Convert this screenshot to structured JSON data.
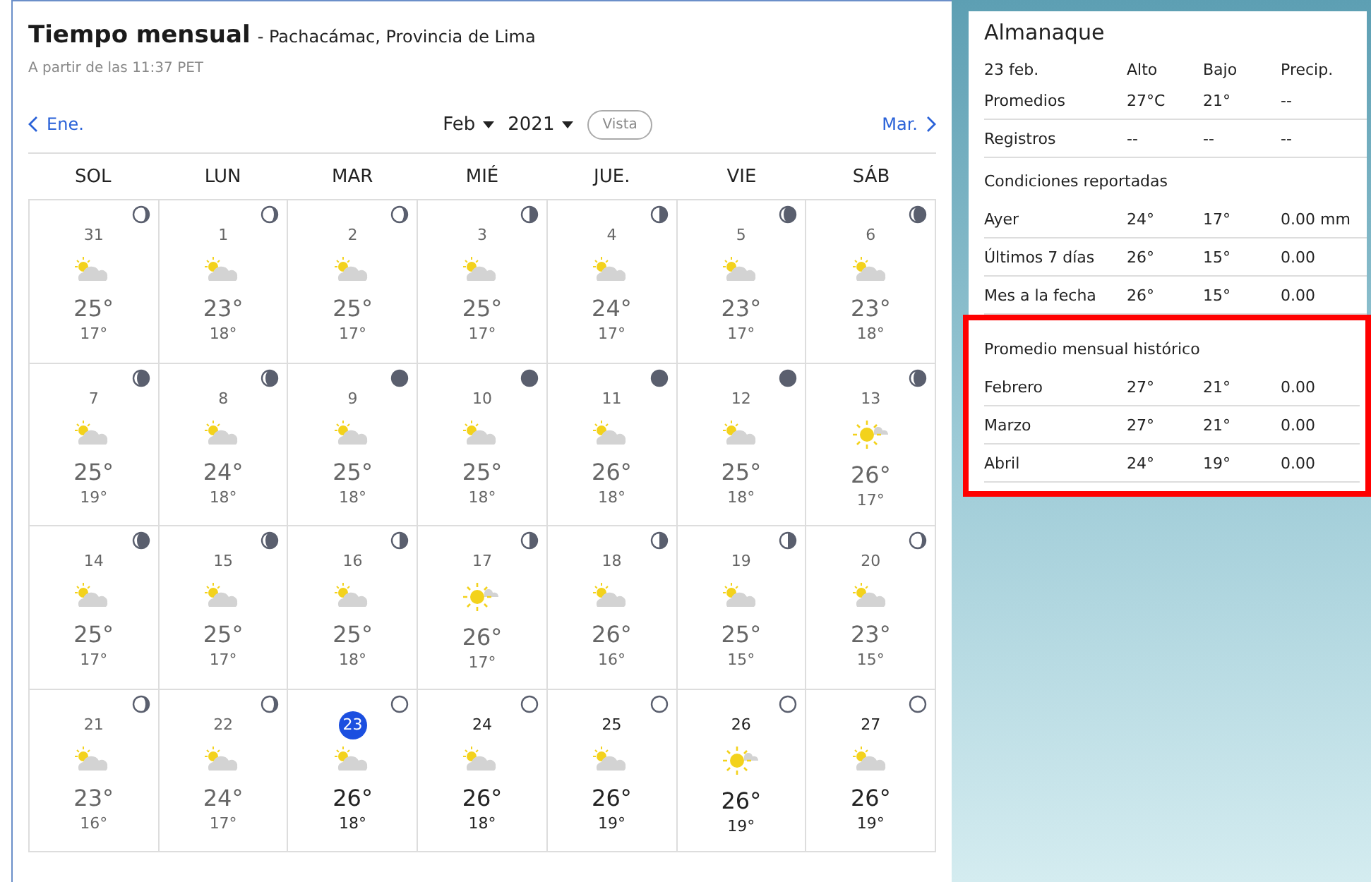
{
  "header": {
    "title": "Tiempo mensual",
    "location": "- Pachacámac, Provincia de Lima",
    "updated": "A partir de las 11:37 PET"
  },
  "nav": {
    "prev": "Ene.",
    "next": "Mar.",
    "month": "Feb",
    "year": "2021",
    "view_button": "Vista"
  },
  "weekdays": [
    "SOL",
    "LUN",
    "MAR",
    "MIÉ",
    "JUE.",
    "VIE",
    "SÁB"
  ],
  "days": [
    {
      "day": "31",
      "high": "25°",
      "low": "17°",
      "kind": "partly",
      "moon": {
        "kind": "crescent"
      },
      "past": true,
      "selected": false
    },
    {
      "day": "1",
      "high": "23°",
      "low": "18°",
      "kind": "partly",
      "moon": {
        "kind": "crescent"
      },
      "past": true,
      "selected": false
    },
    {
      "day": "2",
      "high": "25°",
      "low": "17°",
      "kind": "partly",
      "moon": {
        "kind": "crescent"
      },
      "past": true,
      "selected": false
    },
    {
      "day": "3",
      "high": "25°",
      "low": "17°",
      "kind": "partly",
      "moon": {
        "kind": "half"
      },
      "past": true,
      "selected": false
    },
    {
      "day": "4",
      "high": "24°",
      "low": "17°",
      "kind": "partly",
      "moon": {
        "kind": "half"
      },
      "past": true,
      "selected": false
    },
    {
      "day": "5",
      "high": "23°",
      "low": "17°",
      "kind": "partly",
      "moon": {
        "kind": "gibbous"
      },
      "past": true,
      "selected": false
    },
    {
      "day": "6",
      "high": "23°",
      "low": "18°",
      "kind": "partly",
      "moon": {
        "kind": "gibbous"
      },
      "past": true,
      "selected": false
    },
    {
      "day": "7",
      "high": "25°",
      "low": "19°",
      "kind": "partly",
      "moon": {
        "kind": "gibbous"
      },
      "past": true,
      "selected": false
    },
    {
      "day": "8",
      "high": "24°",
      "low": "18°",
      "kind": "partly",
      "moon": {
        "kind": "gibbous"
      },
      "past": true,
      "selected": false
    },
    {
      "day": "9",
      "high": "25°",
      "low": "18°",
      "kind": "partly",
      "moon": {
        "kind": "full"
      },
      "past": true,
      "selected": false
    },
    {
      "day": "10",
      "high": "25°",
      "low": "18°",
      "kind": "partly",
      "moon": {
        "kind": "full"
      },
      "past": true,
      "selected": false
    },
    {
      "day": "11",
      "high": "26°",
      "low": "18°",
      "kind": "partly",
      "moon": {
        "kind": "full"
      },
      "past": true,
      "selected": false
    },
    {
      "day": "12",
      "high": "25°",
      "low": "18°",
      "kind": "partly",
      "moon": {
        "kind": "full"
      },
      "past": true,
      "selected": false
    },
    {
      "day": "13",
      "high": "26°",
      "low": "17°",
      "kind": "sunny",
      "moon": {
        "kind": "gibbous"
      },
      "past": true,
      "selected": false
    },
    {
      "day": "14",
      "high": "25°",
      "low": "17°",
      "kind": "partly",
      "moon": {
        "kind": "gibbous"
      },
      "past": true,
      "selected": false
    },
    {
      "day": "15",
      "high": "25°",
      "low": "17°",
      "kind": "partly",
      "moon": {
        "kind": "gibbous"
      },
      "past": true,
      "selected": false
    },
    {
      "day": "16",
      "high": "25°",
      "low": "18°",
      "kind": "partly",
      "moon": {
        "kind": "half"
      },
      "past": true,
      "selected": false
    },
    {
      "day": "17",
      "high": "26°",
      "low": "17°",
      "kind": "sunny",
      "moon": {
        "kind": "half"
      },
      "past": true,
      "selected": false
    },
    {
      "day": "18",
      "high": "26°",
      "low": "16°",
      "kind": "partly",
      "moon": {
        "kind": "half"
      },
      "past": true,
      "selected": false
    },
    {
      "day": "19",
      "high": "25°",
      "low": "15°",
      "kind": "partly",
      "moon": {
        "kind": "half"
      },
      "past": true,
      "selected": false
    },
    {
      "day": "20",
      "high": "23°",
      "low": "15°",
      "kind": "partly",
      "moon": {
        "kind": "crescent"
      },
      "past": true,
      "selected": false
    },
    {
      "day": "21",
      "high": "23°",
      "low": "16°",
      "kind": "partly",
      "moon": {
        "kind": "crescent"
      },
      "past": true,
      "selected": false
    },
    {
      "day": "22",
      "high": "24°",
      "low": "17°",
      "kind": "partly",
      "moon": {
        "kind": "crescent"
      },
      "past": true,
      "selected": false
    },
    {
      "day": "23",
      "high": "26°",
      "low": "18°",
      "kind": "partly",
      "moon": {
        "kind": "new"
      },
      "past": false,
      "selected": true
    },
    {
      "day": "24",
      "high": "26°",
      "low": "18°",
      "kind": "partly",
      "moon": {
        "kind": "new"
      },
      "past": false,
      "selected": false
    },
    {
      "day": "25",
      "high": "26°",
      "low": "19°",
      "kind": "partly",
      "moon": {
        "kind": "new"
      },
      "past": false,
      "selected": false
    },
    {
      "day": "26",
      "high": "26°",
      "low": "19°",
      "kind": "sunny",
      "moon": {
        "kind": "new"
      },
      "past": false,
      "selected": false
    },
    {
      "day": "27",
      "high": "26°",
      "low": "19°",
      "kind": "partly",
      "moon": {
        "kind": "new"
      },
      "past": false,
      "selected": false
    }
  ],
  "almanac": {
    "title": "Almanaque",
    "columns": [
      "23 feb.",
      "Alto",
      "Bajo",
      "Precip."
    ],
    "sections": [
      {
        "highlighted": false,
        "rows": [
          [
            "Promedios",
            "27°C",
            "21°",
            "--"
          ],
          [
            "Registros",
            "--",
            "--",
            "--"
          ]
        ]
      },
      {
        "heading": "Condiciones reportadas",
        "highlighted": false,
        "rows": [
          [
            "Ayer",
            "24°",
            "17°",
            "0.00 mm"
          ],
          [
            "Últimos 7 días",
            "26°",
            "15°",
            "0.00"
          ],
          [
            "Mes a la fecha",
            "26°",
            "15°",
            "0.00"
          ]
        ]
      },
      {
        "heading": "Promedio mensual histórico",
        "highlighted": true,
        "rows": [
          [
            "Febrero",
            "27°",
            "21°",
            "0.00"
          ],
          [
            "Marzo",
            "27°",
            "21°",
            "0.00"
          ],
          [
            "Abril",
            "24°",
            "19°",
            "0.00"
          ]
        ]
      }
    ]
  }
}
